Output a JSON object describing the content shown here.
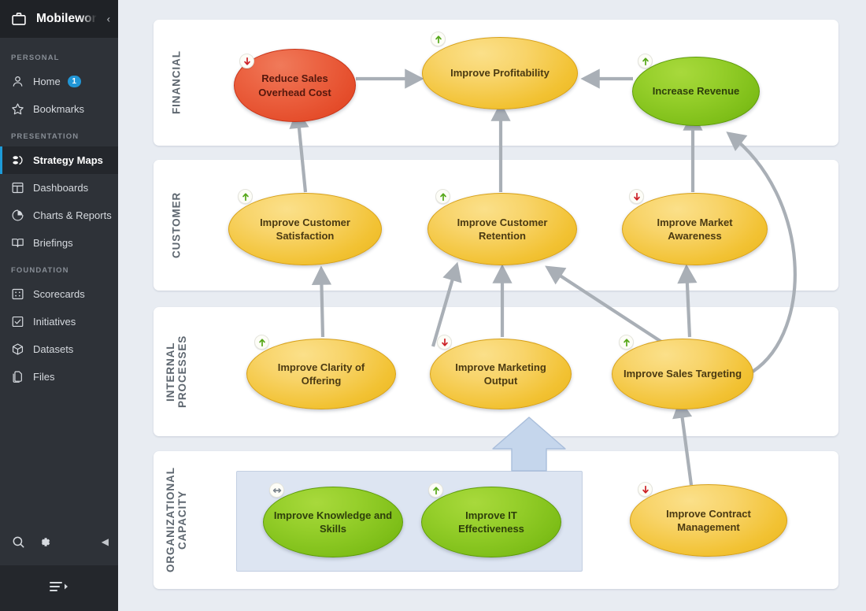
{
  "sidebar": {
    "brand": {
      "icon": "briefcase-icon",
      "title": "Mobilewor"
    },
    "collapse_glyph": "‹",
    "sections": [
      {
        "label": "PERSONAL",
        "items": [
          {
            "label": "Home",
            "icon": "user-icon",
            "badge": "1",
            "active": false
          },
          {
            "label": "Bookmarks",
            "icon": "star-icon",
            "badge": "",
            "active": false
          }
        ]
      },
      {
        "label": "PRESENTATION",
        "items": [
          {
            "label": "Strategy Maps",
            "icon": "strategy-map-icon",
            "badge": "",
            "active": true
          },
          {
            "label": "Dashboards",
            "icon": "dashboard-icon",
            "badge": "",
            "active": false
          },
          {
            "label": "Charts & Reports",
            "icon": "pie-chart-icon",
            "badge": "",
            "active": false
          },
          {
            "label": "Briefings",
            "icon": "book-icon",
            "badge": "",
            "active": false
          }
        ]
      },
      {
        "label": "FOUNDATION",
        "items": [
          {
            "label": "Scorecards",
            "icon": "scorecard-grid-icon",
            "badge": "",
            "active": false
          },
          {
            "label": "Initiatives",
            "icon": "checkbox-icon",
            "badge": "",
            "active": false
          },
          {
            "label": "Datasets",
            "icon": "cube-icon",
            "badge": "",
            "active": false
          },
          {
            "label": "Files",
            "icon": "files-icon",
            "badge": "",
            "active": false
          }
        ]
      }
    ],
    "tools": [
      {
        "icon": "search-icon"
      },
      {
        "icon": "gear-icon"
      }
    ],
    "panel_collapse_glyph": "◀",
    "footer": {
      "icon": "filter-list-icon"
    }
  },
  "colors": {
    "accent": "#1d9bd8",
    "badge": "#2196d6",
    "sidebar_bg": "#2e3238",
    "sidebar_header_bg": "#1f2226",
    "canvas_bg": "#e8ecf2",
    "panel_bg": "#ffffff",
    "connector": "#a9afb6",
    "group_box_bg": "#dde5f2",
    "big_arrow_fill": "#c5d6ec",
    "node_amber": "#f2c233",
    "node_green": "#7fbf19",
    "node_red": "#e54e2c",
    "trend_up": "#55a718",
    "trend_down": "#cc2026",
    "trend_flat": "#7c858e"
  },
  "map": {
    "perspectives": [
      {
        "id": "financial",
        "label": "FINANCIAL"
      },
      {
        "id": "customer",
        "label": "CUSTOMER"
      },
      {
        "id": "internal",
        "label": "INTERNAL\nPROCESSES"
      },
      {
        "id": "organizational",
        "label": "ORGANIZATIONAL\nCAPACITY"
      }
    ],
    "nodes": [
      {
        "id": "reduce-sales-overhead-cost",
        "label": "Reduce Sales Overhead Cost",
        "status": "red",
        "trend": "down"
      },
      {
        "id": "improve-profitability",
        "label": "Improve Profitability",
        "status": "amber",
        "trend": "up"
      },
      {
        "id": "increase-revenue",
        "label": "Increase Revenue",
        "status": "green",
        "trend": "up"
      },
      {
        "id": "improve-customer-satisfaction",
        "label": "Improve Customer Satisfaction",
        "status": "amber",
        "trend": "up"
      },
      {
        "id": "improve-customer-retention",
        "label": "Improve Customer Retention",
        "status": "amber",
        "trend": "up"
      },
      {
        "id": "improve-market-awareness",
        "label": "Improve Market Awareness",
        "status": "amber",
        "trend": "down"
      },
      {
        "id": "improve-clarity-of-offering",
        "label": "Improve Clarity of Offering",
        "status": "amber",
        "trend": "up"
      },
      {
        "id": "improve-marketing-output",
        "label": "Improve Marketing Output",
        "status": "amber",
        "trend": "down"
      },
      {
        "id": "improve-sales-targeting",
        "label": "Improve Sales Targeting",
        "status": "amber",
        "trend": "up"
      },
      {
        "id": "improve-knowledge-and-skills",
        "label": "Improve Knowledge and Skills",
        "status": "green",
        "trend": "flat"
      },
      {
        "id": "improve-it-effectiveness",
        "label": "Improve IT Effectiveness",
        "status": "green",
        "trend": "up"
      },
      {
        "id": "improve-contract-management",
        "label": "Improve Contract Management",
        "status": "amber",
        "trend": "down"
      }
    ]
  }
}
